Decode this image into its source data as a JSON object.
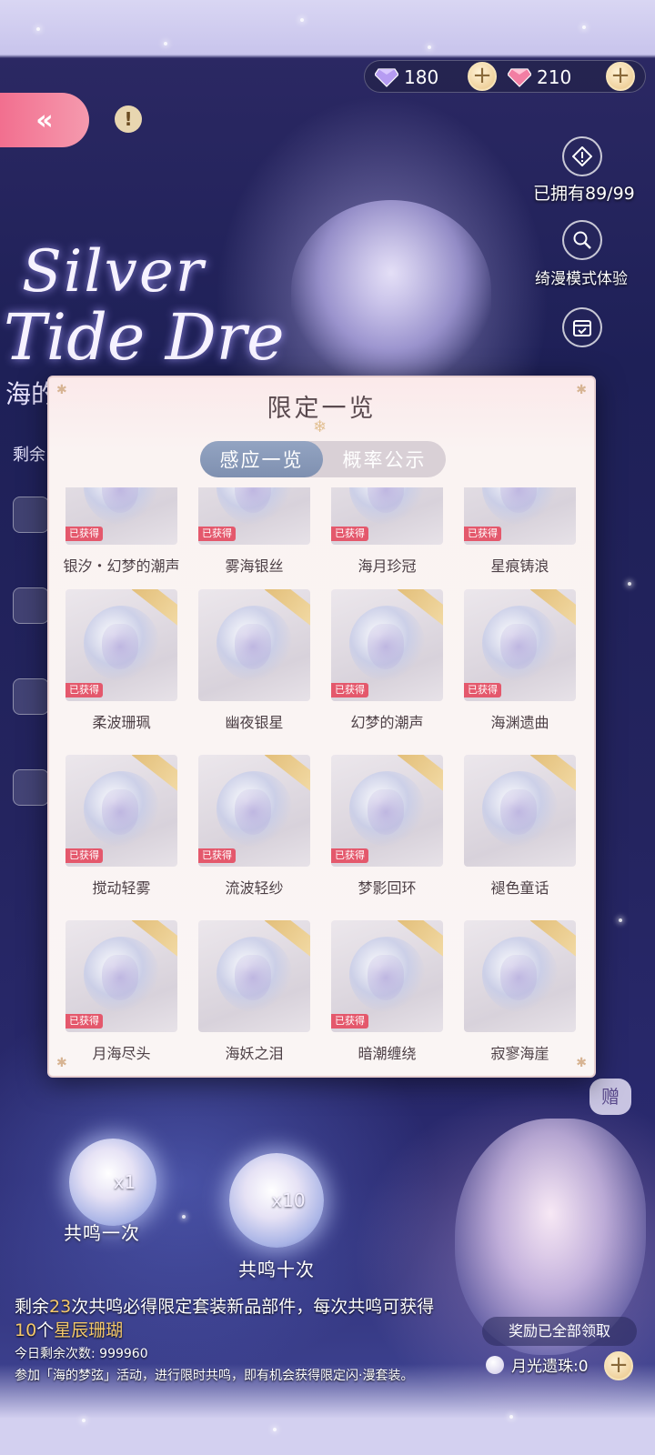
{
  "currency": {
    "purple_gems": "180",
    "pink_gems": "210",
    "purple_icon": "purple-diamond-icon",
    "pink_icon": "pink-diamond-icon"
  },
  "nav": {
    "back_icon": "«",
    "info_icon": "!"
  },
  "side": {
    "owned_label": "已拥有89/99",
    "experience_label": "绮漫模式体验"
  },
  "title": {
    "line1": "Silver",
    "line2": "Tide Dre",
    "subtitle": "海的",
    "remaining_prefix": "剩余"
  },
  "modal": {
    "title": "限定一览",
    "tabs": [
      {
        "label": "感应一览",
        "active": true
      },
      {
        "label": "概率公示",
        "active": false
      }
    ],
    "owned_badge": "已获得",
    "items": [
      {
        "name": "银汐・幻梦的潮声",
        "owned": true,
        "row": 0
      },
      {
        "name": "雾海银丝",
        "owned": true,
        "row": 0
      },
      {
        "name": "海月珍冠",
        "owned": true,
        "row": 0
      },
      {
        "name": "星痕铸浪",
        "owned": true,
        "row": 0
      },
      {
        "name": "柔波珊珮",
        "owned": true,
        "row": 1
      },
      {
        "name": "幽夜银星",
        "owned": false,
        "row": 1
      },
      {
        "name": "幻梦的潮声",
        "owned": true,
        "row": 1
      },
      {
        "name": "海渊遗曲",
        "owned": true,
        "row": 1
      },
      {
        "name": "搅动轻雾",
        "owned": true,
        "row": 2
      },
      {
        "name": "流波轻纱",
        "owned": true,
        "row": 2
      },
      {
        "name": "梦影回环",
        "owned": true,
        "row": 2
      },
      {
        "name": "褪色童话",
        "owned": false,
        "row": 2
      },
      {
        "name": "月海尽头",
        "owned": true,
        "row": 3
      },
      {
        "name": "海妖之泪",
        "owned": false,
        "row": 3
      },
      {
        "name": "暗潮缠绕",
        "owned": true,
        "row": 3
      },
      {
        "name": "寂寥海崖",
        "owned": false,
        "row": 3
      }
    ]
  },
  "bottom": {
    "once_count": "x1",
    "once_label": "共鸣一次",
    "ten_count": "x10",
    "ten_label": "共鸣十次",
    "gift_badge": "赠",
    "info_part1": "剩余",
    "info_remaining": "23",
    "info_part2": "次共鸣必得限定套装新品部件，每次共鸣可获得",
    "info_coral_count": "10",
    "info_part3": "个",
    "info_coral_name": "星辰珊瑚",
    "rewards_claimed": "奖励已全部领取",
    "daily_remaining": "今日剩余次数: 999960",
    "activity_note": "参加「海的梦弦」活动，进行限时共鸣，即有机会获得限定闪·漫套装。",
    "pearl_label": "月光遗珠:0"
  }
}
